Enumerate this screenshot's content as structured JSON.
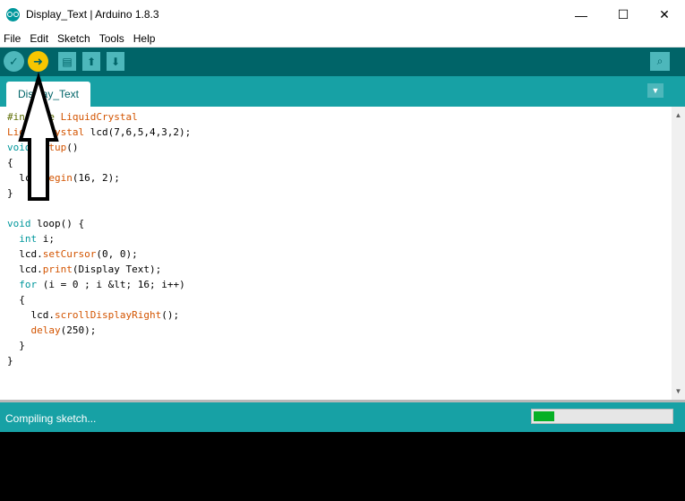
{
  "window": {
    "title": "Display_Text | Arduino 1.8.3",
    "min_glyph": "—",
    "max_glyph": "☐",
    "close_glyph": "✕"
  },
  "menu": [
    "File",
    "Edit",
    "Sketch",
    "Tools",
    "Help"
  ],
  "toolbar": {
    "verify_icon": "check-icon",
    "upload_icon": "arrow-right-icon",
    "new_icon": "document-icon",
    "open_icon": "arrow-up-icon",
    "save_icon": "arrow-down-icon",
    "monitor_icon": "magnifier-icon",
    "verify_glyph": "✓",
    "upload_glyph": "➜",
    "new_glyph": "▤",
    "open_glyph": "⬆",
    "save_glyph": "⬇",
    "monitor_glyph": "⌕"
  },
  "tabs": [
    {
      "label": "Display_Text"
    }
  ],
  "tab_menu_glyph": "▼",
  "code_lines": [
    [
      [
        "kw1",
        "#include "
      ],
      [
        "kw2",
        "LiquidCrystal"
      ]
    ],
    [
      [
        "kw2",
        "LiquidCrystal"
      ],
      [
        "",
        " lcd(7,6,5,4,3,2);"
      ]
    ],
    [
      [
        "kw3",
        "void"
      ],
      [
        "",
        " "
      ],
      [
        "kw2",
        "setup"
      ],
      [
        "",
        "()"
      ]
    ],
    [
      [
        "",
        "{"
      ]
    ],
    [
      [
        "",
        "  lcd."
      ],
      [
        "kw2",
        "begin"
      ],
      [
        "",
        "(16, 2);"
      ]
    ],
    [
      [
        "",
        "}"
      ]
    ],
    [
      [
        "",
        ""
      ]
    ],
    [
      [
        "kw3",
        "void"
      ],
      [
        "",
        " loop() {"
      ]
    ],
    [
      [
        "",
        "  "
      ],
      [
        "kw3",
        "int"
      ],
      [
        "",
        " i;"
      ]
    ],
    [
      [
        "",
        "  lcd."
      ],
      [
        "kw2",
        "setCursor"
      ],
      [
        "",
        "(0, 0);"
      ]
    ],
    [
      [
        "",
        "  lcd."
      ],
      [
        "kw2",
        "print"
      ],
      [
        "",
        "(Display Text);"
      ]
    ],
    [
      [
        "",
        "  "
      ],
      [
        "kw3",
        "for"
      ],
      [
        "",
        " (i = 0 ; i &lt; 16; i++)"
      ]
    ],
    [
      [
        "",
        "  {"
      ]
    ],
    [
      [
        "",
        "    lcd."
      ],
      [
        "kw2",
        "scrollDisplayRight"
      ],
      [
        "",
        "();"
      ]
    ],
    [
      [
        "",
        "    "
      ],
      [
        "kw2",
        "delay"
      ],
      [
        "",
        "(250);"
      ]
    ],
    [
      [
        "",
        "  }"
      ]
    ],
    [
      [
        "",
        "}"
      ]
    ]
  ],
  "status": {
    "text": "Compiling sketch...",
    "progress": 0.17
  },
  "colors": {
    "toolbar": "#006468",
    "tabbar": "#17a1a5",
    "upload_button": "#f7c600",
    "progress_fill": "#06b025"
  }
}
